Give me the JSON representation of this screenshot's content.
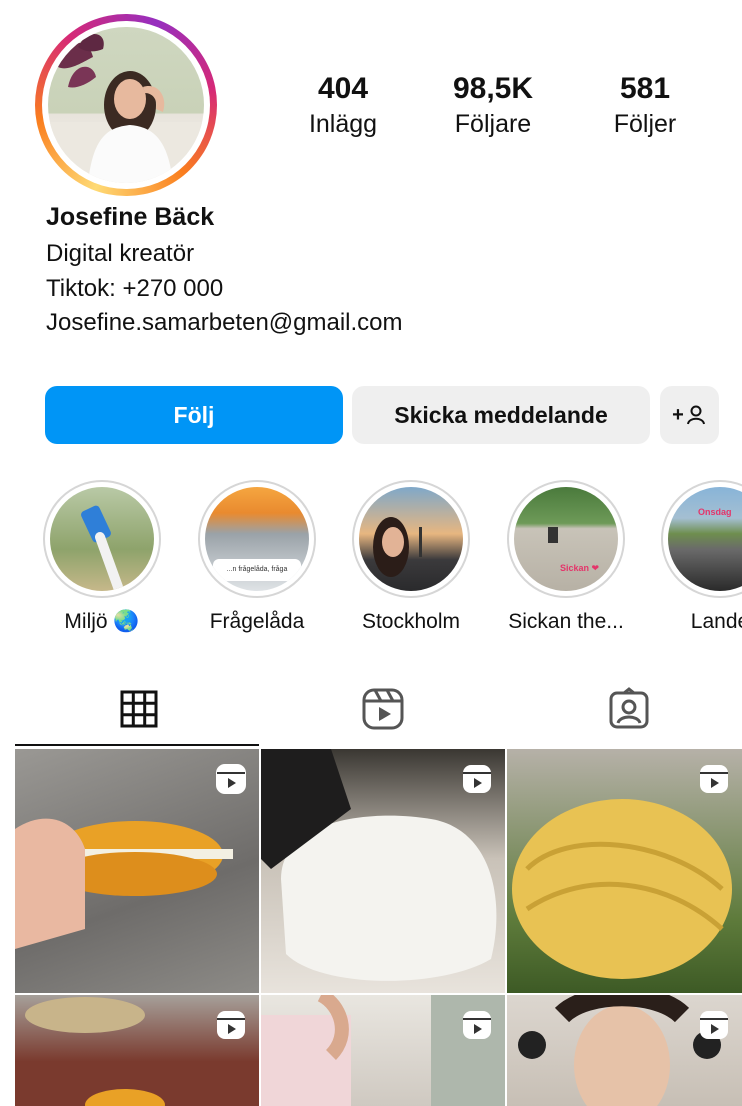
{
  "profile": {
    "name": "Josefine Bäck",
    "bio": [
      "Digital kreatör",
      "Tiktok: +270 000",
      "Josefine.samarbeten@gmail.com"
    ]
  },
  "stats": [
    {
      "value": "404",
      "label": "Inlägg"
    },
    {
      "value": "98,5K",
      "label": "Följare"
    },
    {
      "value": "581",
      "label": "Följer"
    }
  ],
  "actions": {
    "follow": "Följ",
    "message": "Skicka meddelande",
    "add_user": "+"
  },
  "highlights": [
    {
      "label": "Miljö 🌏"
    },
    {
      "label": "Frågelåda"
    },
    {
      "label": "Stockholm"
    },
    {
      "label": "Sickan the..."
    },
    {
      "label": "Lande"
    }
  ],
  "highlight_captions": {
    "fragelada": "...n frågelåda, fråga",
    "sickan": "Sickan ❤",
    "lande": "Onsdag"
  },
  "tabs": [
    {
      "name": "grid",
      "icon": "grid-icon",
      "active": true
    },
    {
      "name": "reels",
      "icon": "reels-icon",
      "active": false
    },
    {
      "name": "tagged",
      "icon": "tagged-icon",
      "active": false
    }
  ],
  "colors": {
    "accent": "#0095f6",
    "button_grey": "#efefef",
    "ring_border": "#d6d6d6"
  }
}
